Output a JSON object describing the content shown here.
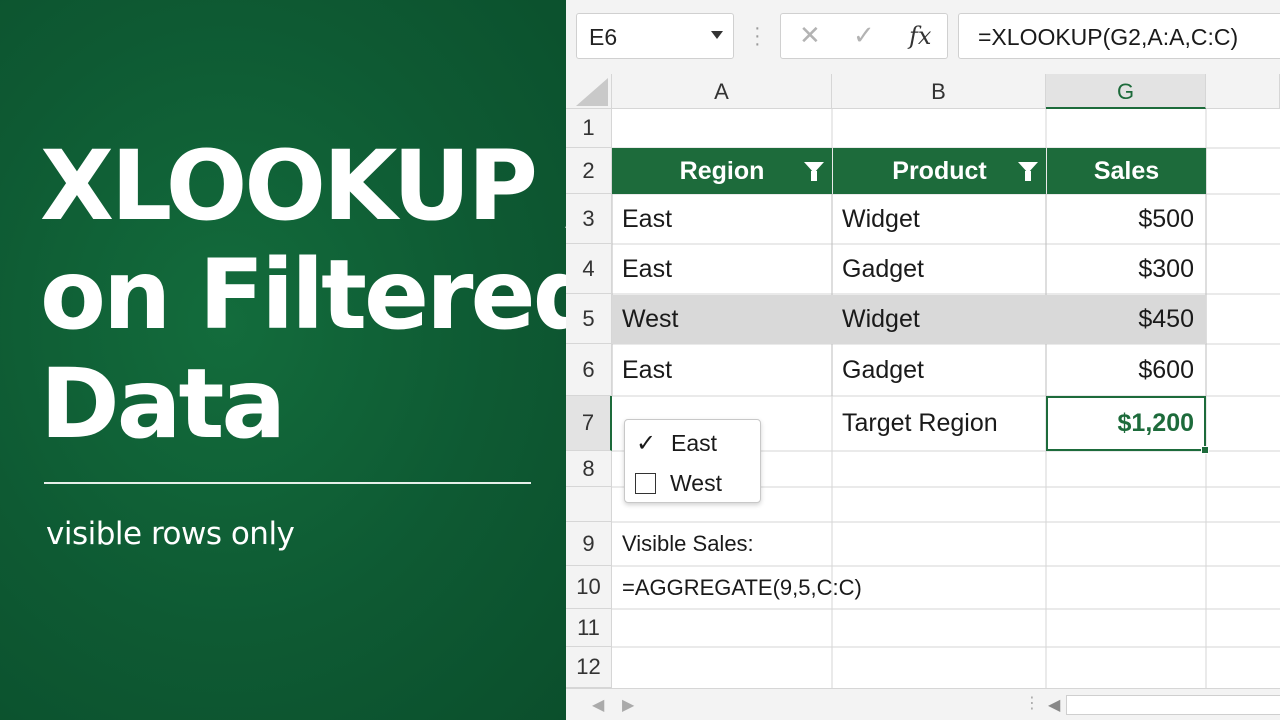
{
  "thumbnail": {
    "headline_lines": [
      "XLOOKUP /",
      "on Filtered",
      "Data"
    ],
    "subtitle": "visible rows only",
    "brand_color": "#1d6b3b"
  },
  "formula_bar": {
    "name_box": "E6",
    "cancel_icon": "✕",
    "enter_icon": "✓",
    "fx_label": "fx",
    "formula": "=XLOOKUP(G2,A:A,C:C)"
  },
  "grid": {
    "columns": [
      "A",
      "B",
      "G"
    ],
    "active_column": "G",
    "rows": [
      "1",
      "2",
      "3",
      "4",
      "5",
      "6",
      "7",
      "8",
      "9",
      "10",
      "11",
      "12"
    ],
    "active_row": "7",
    "table_headers": [
      "Region",
      "Product",
      "Sales"
    ],
    "table_rows": [
      {
        "region": "East",
        "product": "Widget",
        "sales": "$500"
      },
      {
        "region": "East",
        "product": "Gadget",
        "sales": "$300"
      },
      {
        "region": "West",
        "product": "Widget",
        "sales": "$450",
        "shaded": true
      },
      {
        "region": "East",
        "product": "Gadget",
        "sales": "$600"
      }
    ],
    "target_label": "Target Region",
    "result_value": "$1,200",
    "visible_sales_label": "Visible Sales:",
    "aggregate_formula": "=AGGREGATE(9,5,C:C)"
  },
  "filter_dropdown": {
    "options": [
      {
        "label": "East",
        "checked": true
      },
      {
        "label": "West",
        "checked": false
      }
    ]
  },
  "bottom_bar": {
    "prev_icon": "◀",
    "next_icon": "▶",
    "scroll_left_icon": "◀",
    "separator": "⋮"
  }
}
